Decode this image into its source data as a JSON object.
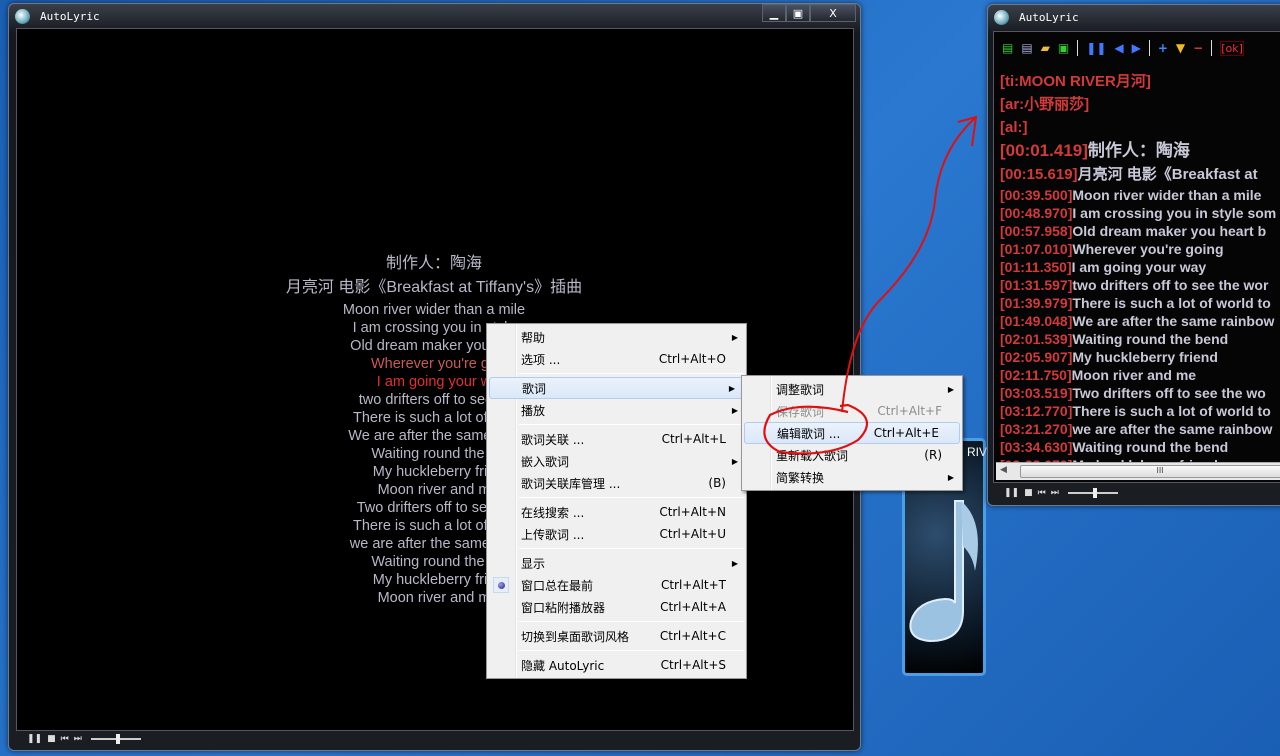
{
  "left_window": {
    "title": "AutoLyric",
    "buttons": {
      "minimize": "▁",
      "restore": "▣",
      "close": "X"
    },
    "lyrics": [
      {
        "text": "制作人：陶海",
        "state": "normal"
      },
      {
        "text": "月亮河 电影《Breakfast at Tiffany's》插曲",
        "state": "normal"
      },
      {
        "text": "Moon river wider than a mile",
        "state": "normal"
      },
      {
        "text": "I am crossing you in style",
        "state": "normal"
      },
      {
        "text": "Old dream maker  you hea",
        "state": "normal"
      },
      {
        "text": "Wherever you're go",
        "state": "past"
      },
      {
        "text": "I am going your w",
        "state": "current"
      },
      {
        "text": "two drifters off to see th",
        "state": "normal"
      },
      {
        "text": "There is such a lot of wor",
        "state": "normal"
      },
      {
        "text": "We are after the same rain",
        "state": "normal"
      },
      {
        "text": "Waiting round the b",
        "state": "normal"
      },
      {
        "text": "My huckleberry frie",
        "state": "normal"
      },
      {
        "text": "Moon river and m",
        "state": "normal"
      },
      {
        "text": "Two drifters off to see th",
        "state": "normal"
      },
      {
        "text": "There is such a lot of wor",
        "state": "normal"
      },
      {
        "text": "we are after the same rain",
        "state": "normal"
      },
      {
        "text": "Waiting round the b",
        "state": "normal"
      },
      {
        "text": "My huckleberry frie",
        "state": "normal"
      },
      {
        "text": "Moon river and m",
        "state": "normal"
      }
    ],
    "controls": {
      "pause": "❚❚",
      "stop": "■",
      "prev": "⏮",
      "next": "⏭",
      "volume": 0.5
    }
  },
  "context_menu": {
    "items": [
      {
        "label": "帮助",
        "shortcut": "",
        "submenu": true
      },
      {
        "label": "选项 ...",
        "shortcut": "Ctrl+Alt+O"
      },
      {
        "sep": true
      },
      {
        "label": "歌词",
        "shortcut": "",
        "submenu": true,
        "highlighted": true
      },
      {
        "label": "播放",
        "shortcut": "",
        "submenu": true
      },
      {
        "sep": true
      },
      {
        "label": "歌词关联 ...",
        "shortcut": "Ctrl+Alt+L"
      },
      {
        "label": "嵌入歌词",
        "shortcut": "",
        "submenu": true
      },
      {
        "label": "歌词关联库管理 ...",
        "shortcut": "(B)"
      },
      {
        "sep": true
      },
      {
        "label": "在线搜索 ...",
        "shortcut": "Ctrl+Alt+N"
      },
      {
        "label": "上传歌词 ...",
        "shortcut": "Ctrl+Alt+U"
      },
      {
        "sep": true
      },
      {
        "label": "显示",
        "shortcut": "",
        "submenu": true
      },
      {
        "label": "窗口总在最前",
        "shortcut": "Ctrl+Alt+T",
        "checked": true
      },
      {
        "label": "窗口粘附播放器",
        "shortcut": "Ctrl+Alt+A"
      },
      {
        "sep": true
      },
      {
        "label": "切换到桌面歌词风格",
        "shortcut": "Ctrl+Alt+C"
      },
      {
        "sep": true
      },
      {
        "label": "隐藏 AutoLyric",
        "shortcut": "Ctrl+Alt+S"
      }
    ]
  },
  "submenu": {
    "items": [
      {
        "label": "调整歌词",
        "shortcut": "",
        "submenu": true
      },
      {
        "label": "保存歌词",
        "shortcut": "Ctrl+Alt+F",
        "disabled": true
      },
      {
        "label": "编辑歌词 ...",
        "shortcut": "Ctrl+Alt+E",
        "highlighted": true
      },
      {
        "label": "重新载入歌词",
        "shortcut": "(R)"
      },
      {
        "label": "简繁转换",
        "shortcut": "",
        "submenu": true
      }
    ]
  },
  "editor_window": {
    "title": "AutoLyric",
    "toolbar": [
      "new-icon",
      "list-icon",
      "open-folder-icon",
      "save-icon",
      "pause-icon",
      "step-back-icon",
      "step-forward-icon",
      "plus-icon",
      "down-triangle-icon",
      "minus-icon"
    ],
    "ok_label": "[ok]",
    "tags": [
      "[ti:MOON RIVER月河]",
      "[ar:小野丽莎]",
      "[al:]"
    ],
    "lines": [
      [
        "[00:01.419]",
        "制作人：陶海"
      ],
      [
        "[00:15.619]",
        "月亮河 电影《Breakfast at"
      ],
      [
        "[00:39.500]",
        "Moon river wider than a mile"
      ],
      [
        "[00:48.970]",
        "I am crossing you in style som"
      ],
      [
        "[00:57.958]",
        "Old dream maker  you heart b"
      ],
      [
        "[01:07.010]",
        "Wherever you're going"
      ],
      [
        "[01:11.350]",
        "I am going your way"
      ],
      [
        "[01:31.597]",
        "two drifters off to see the wor"
      ],
      [
        "[01:39.979]",
        "There is such a lot of world to"
      ],
      [
        "[01:49.048]",
        "We are after the same rainbow"
      ],
      [
        "[02:01.539]",
        "Waiting round the bend"
      ],
      [
        "[02:05.907]",
        "My huckleberry friend"
      ],
      [
        "[02:11.750]",
        "Moon river and me"
      ],
      [
        "[03:03.519]",
        "Two drifters off to see the wo"
      ],
      [
        "[03:12.770]",
        "There is such a lot of world to"
      ],
      [
        "[03:21.270]",
        "we are after the same rainbow"
      ],
      [
        "[03:34.630]",
        "Waiting round the bend"
      ],
      [
        "[03:38.979]",
        "My huckleberry friend"
      ]
    ],
    "scroll_grip": "III"
  },
  "background_player": {
    "title_fragment": "RIV"
  },
  "colors": {
    "timestamp": "#d23a3a",
    "current_lyric": "#e03030",
    "annotation": "#e01010"
  }
}
